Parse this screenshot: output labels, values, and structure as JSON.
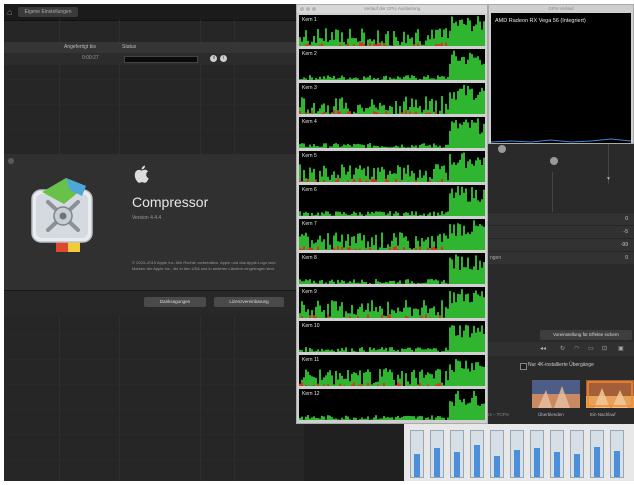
{
  "queue": {
    "tab_label": "Eigene Einstellungen",
    "columns": [
      "Angefertigt bis",
      "Status"
    ],
    "rows": [
      {
        "time": "0:00:27"
      }
    ],
    "icons": [
      "pause-icon",
      "info-icon"
    ]
  },
  "about": {
    "app_name": "Compressor",
    "version": "Version 4.4.4",
    "copyright": "© 2003–2019 Apple Inc. Alle Rechte vorbehalten. Apple und das Apple-Logo sind Marken der Apple Inc., die in den USA und in anderen Ländern eingetragen sind.",
    "buttons": [
      "Danksagungen",
      "Lizenzvereinbarung"
    ]
  },
  "cpu_window": {
    "title": "Verlauf der CPU-Auslastung",
    "cores": [
      "Kern 1",
      "Kern 2",
      "Kern 3",
      "Kern 4",
      "Kern 5",
      "Kern 6",
      "Kern 7",
      "Kern 8",
      "Kern 9",
      "Kern 10",
      "Kern 11",
      "Kern 12"
    ],
    "colors": {
      "user": "#2fb52f",
      "system": "#d8322a",
      "background": "#000000"
    }
  },
  "gpu_window": {
    "title": "GPU-Verlauf",
    "label": "AMD Radeon RX Vega 56 (Integriert)"
  },
  "editor": {
    "param_rows": [
      {
        "label": "",
        "value": "0"
      },
      {
        "label": "",
        "value": "-5"
      },
      {
        "label": "",
        "value": "-99"
      },
      {
        "label": "ngen",
        "value": "0"
      }
    ],
    "effect_button": "Voreinstellung für Effekte sichern",
    "installed_label": "Nur 4K-installierte Übergänge",
    "thumbnails": [
      {
        "label": "Überblenden",
        "color_a": "#6b7fa8",
        "color_b": "#d98a5a"
      },
      {
        "label": "Ein Nachlauf",
        "color_a": "#a5603a",
        "color_b": "#e6a05b"
      }
    ],
    "left_cut_label": "rs – TCFN"
  }
}
